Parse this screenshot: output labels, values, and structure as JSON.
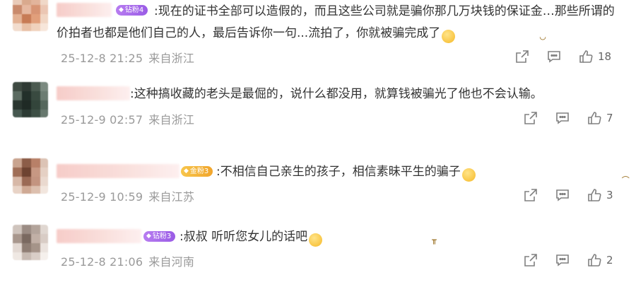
{
  "comments": [
    {
      "badge_label": "钻粉4",
      "badge_style": "purple",
      "text": ":现在的证书全部可以造假的，而且这些公司就是骗你那几万块钱的保证金…那些所谓的价拍者也都是他们自己的人，最后告诉你一句...流拍了，你就被骗完成了",
      "emoji": "mocking-face-emoji",
      "date": "25-12-8 21:25",
      "location": "来自浙江",
      "likes": "18"
    },
    {
      "badge_label": "",
      "badge_style": "none",
      "text": ":这种搞收藏的老头是最倔的，说什么都没用，就算钱被骗光了他也不会认输。",
      "emoji": "",
      "date": "25-12-9 02:57",
      "location": "来自浙江",
      "likes": "7"
    },
    {
      "badge_label": "金粉3",
      "badge_style": "gold",
      "text": ":不相信自己亲生的孩子，相信素昧平生的骗子",
      "emoji": "sad-face-emoji",
      "date": "25-12-9 10:59",
      "location": "来自江苏",
      "likes": "3"
    },
    {
      "badge_label": "钻粉3",
      "badge_style": "purple",
      "text": ":叔叔 听听您女儿的话吧",
      "emoji": "crying-face-emoji",
      "date": "25-12-8 21:06",
      "location": "来自河南",
      "likes": "2"
    }
  ],
  "icons": {
    "share": "share-icon",
    "reply": "comment-icon",
    "like": "thumbs-up-icon"
  },
  "colors": {
    "text": "#333333",
    "meta": "#9a9a9a",
    "icon": "#808080",
    "badge_purple": "#a066ea",
    "badge_gold": "#f3b13a"
  }
}
